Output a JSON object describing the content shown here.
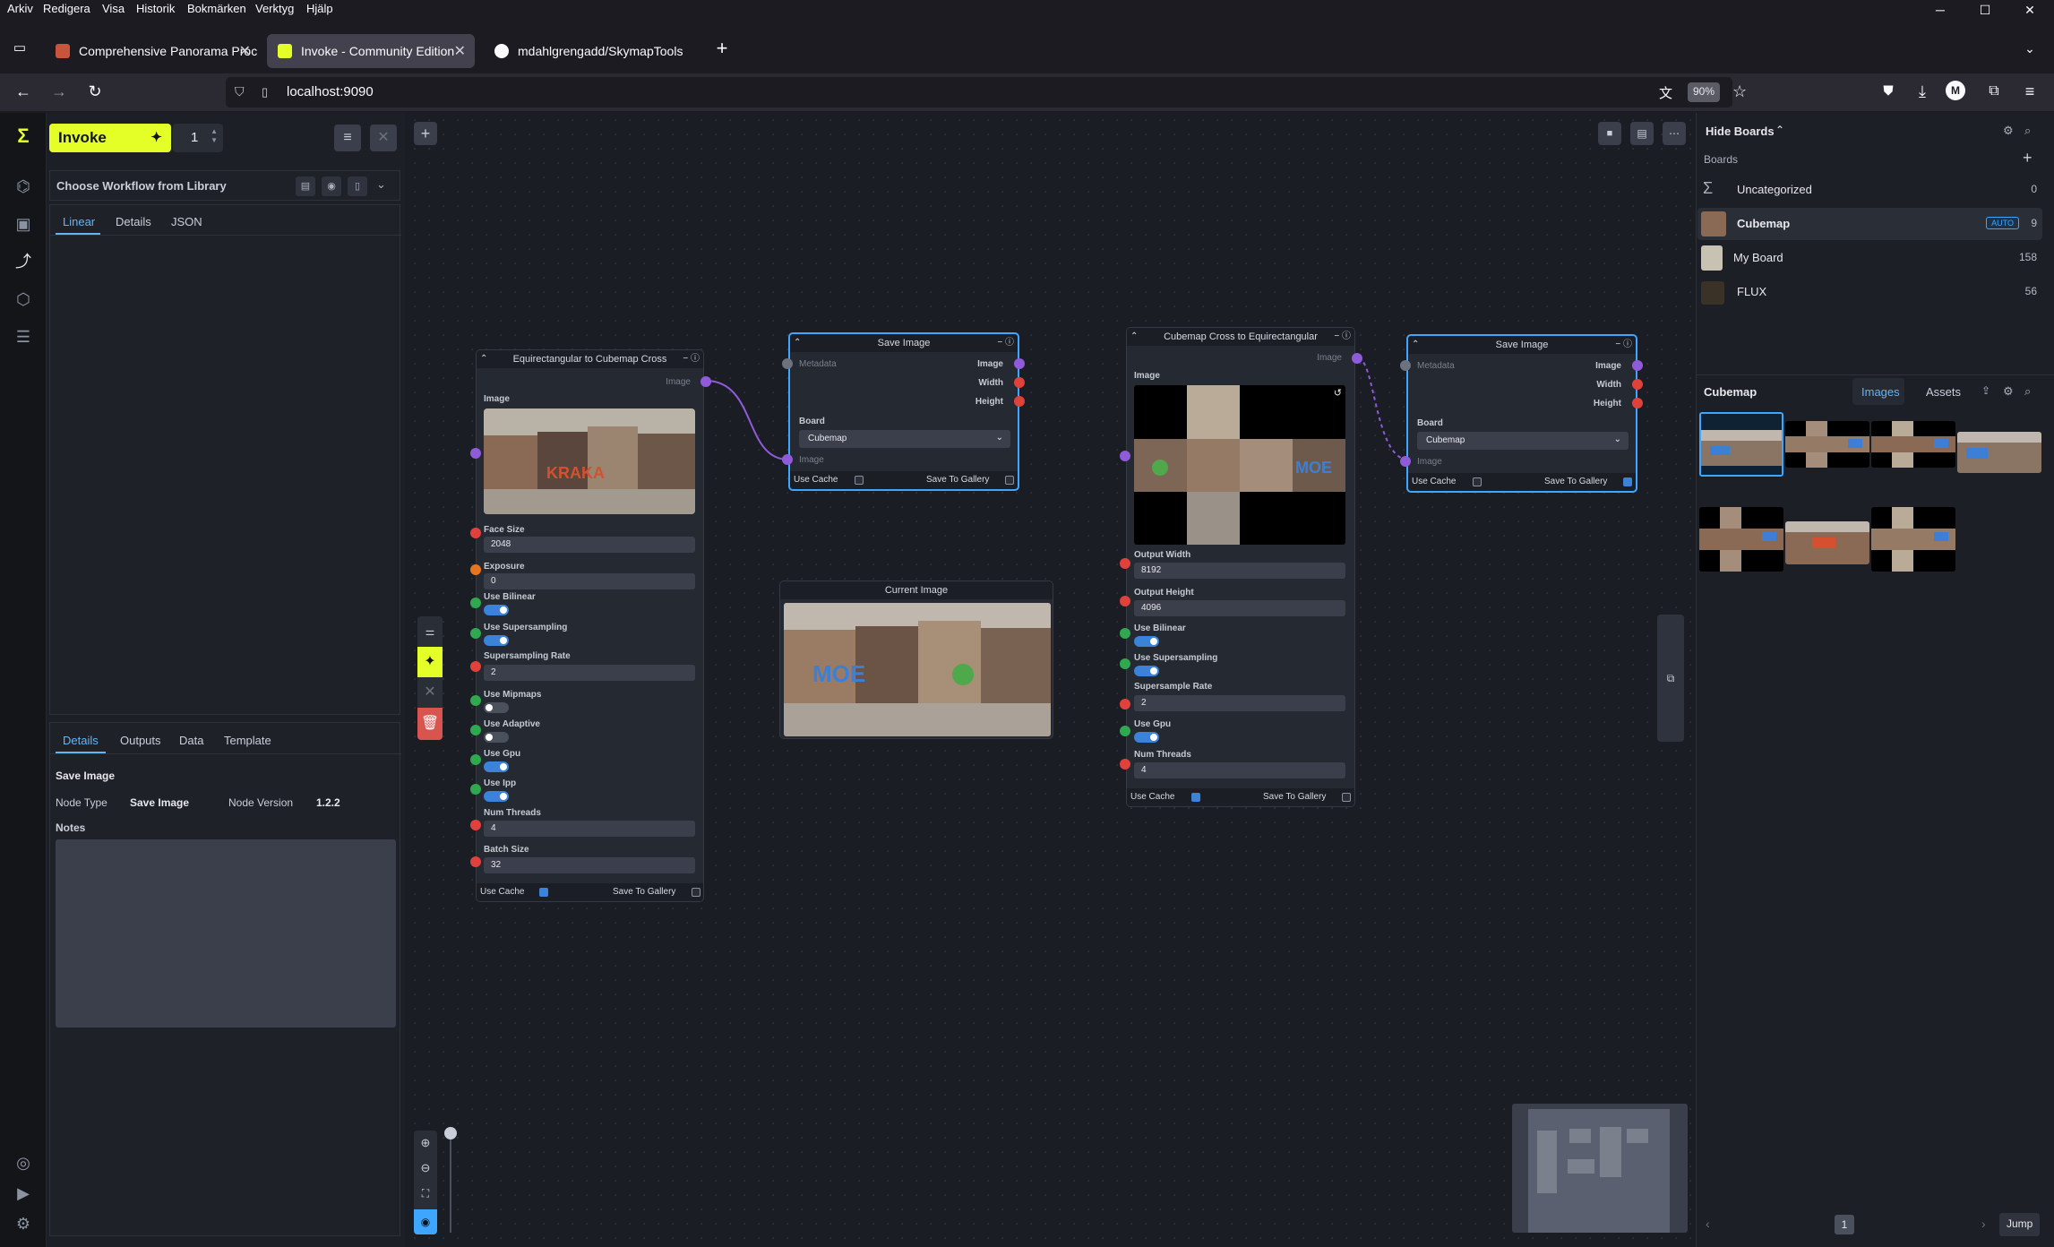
{
  "browser": {
    "menu": [
      "Arkiv",
      "Redigera",
      "Visa",
      "Historik",
      "Bokmärken",
      "Verktyg",
      "Hjälp"
    ],
    "tabs": [
      {
        "label": "Comprehensive Panorama Proc"
      },
      {
        "label": "Invoke - Community Edition"
      },
      {
        "label": "mdahlgrengadd/SkymapTools"
      }
    ],
    "url": "localhost:9090",
    "zoom": "90%"
  },
  "left": {
    "invoke_label": "Invoke",
    "batch_count": "1",
    "workflow_title": "Choose Workflow from Library",
    "top_tabs": [
      "Linear",
      "Details",
      "JSON"
    ],
    "bottom_tabs": [
      "Details",
      "Outputs",
      "Data",
      "Template"
    ],
    "details": {
      "heading": "Save Image",
      "node_type_label": "Node Type",
      "node_type_value": "Save Image",
      "node_version_label": "Node Version",
      "node_version_value": "1.2.2",
      "notes_label": "Notes"
    }
  },
  "nodes": {
    "equirect_to_cube": {
      "title": "Equirectangular to Cubemap Cross",
      "out_image": "Image",
      "image_label": "Image",
      "face_size_label": "Face Size",
      "face_size": "2048",
      "exposure_label": "Exposure",
      "exposure": "0",
      "use_bilinear": "Use Bilinear",
      "use_supersampling": "Use Supersampling",
      "supersampling_rate_label": "Supersampling Rate",
      "supersampling_rate": "2",
      "use_mipmaps": "Use Mipmaps",
      "use_adaptive": "Use Adaptive",
      "use_gpu": "Use Gpu",
      "use_ipp": "Use Ipp",
      "num_threads_label": "Num Threads",
      "num_threads": "4",
      "batch_size_label": "Batch Size",
      "batch_size": "32",
      "use_cache": "Use Cache",
      "save_to_gallery": "Save To Gallery"
    },
    "save_image_1": {
      "title": "Save Image",
      "metadata": "Metadata",
      "out_image": "Image",
      "out_width": "Width",
      "out_height": "Height",
      "board_label": "Board",
      "board_value": "Cubemap",
      "in_image": "Image",
      "use_cache": "Use Cache",
      "save_to_gallery": "Save To Gallery"
    },
    "current_image": {
      "title": "Current Image"
    },
    "cube_to_equirect": {
      "title": "Cubemap Cross to Equirectangular",
      "out_image": "Image",
      "image_label": "Image",
      "output_width_label": "Output Width",
      "output_width": "8192",
      "output_height_label": "Output Height",
      "output_height": "4096",
      "use_bilinear": "Use Bilinear",
      "use_supersampling": "Use Supersampling",
      "supersample_rate_label": "Supersample Rate",
      "supersample_rate": "2",
      "use_gpu": "Use Gpu",
      "num_threads_label": "Num Threads",
      "num_threads": "4",
      "use_cache": "Use Cache",
      "save_to_gallery": "Save To Gallery"
    },
    "save_image_2": {
      "title": "Save Image",
      "metadata": "Metadata",
      "out_image": "Image",
      "out_width": "Width",
      "out_height": "Height",
      "board_label": "Board",
      "board_value": "Cubemap",
      "in_image": "Image",
      "use_cache": "Use Cache",
      "save_to_gallery": "Save To Gallery"
    }
  },
  "right": {
    "hide_boards": "Hide Boards",
    "boards_label": "Boards",
    "boards": [
      {
        "name": "Uncategorized",
        "count": "0"
      },
      {
        "name": "Cubemap",
        "count": "9",
        "badge": "AUTO"
      },
      {
        "name": "My Board",
        "count": "158"
      },
      {
        "name": "FLUX",
        "count": "56"
      }
    ],
    "gallery_title": "Cubemap",
    "gallery_tabs": [
      "Images",
      "Assets"
    ],
    "page": "1",
    "jump": "Jump"
  },
  "colors": {
    "accent": "#e4fe27",
    "selection": "#3ea6ff",
    "image_port": "#8f5bd9",
    "int_port": "#e0413b",
    "bool_port": "#2fa84f"
  }
}
